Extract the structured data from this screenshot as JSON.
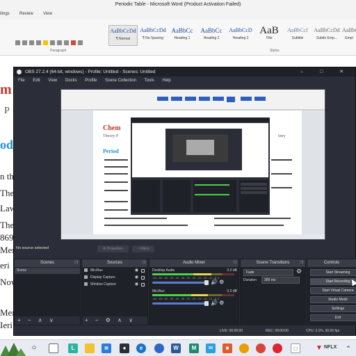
{
  "word": {
    "title": "Periodic Table  -  Microsoft Word (Product Activation Failed)",
    "tabs": [
      "ilings",
      "Review",
      "View"
    ],
    "styles": [
      {
        "preview": "AaBbCcDd",
        "name": "¶ Normal"
      },
      {
        "preview": "AaBbCcDd",
        "name": "¶ No Spacing"
      },
      {
        "preview": "AaBbCc",
        "name": "Heading 1"
      },
      {
        "preview": "AaBbCc",
        "name": "Heading 2"
      },
      {
        "preview": "AaBbCcD",
        "name": "Heading 3"
      },
      {
        "preview": "AaB",
        "name": "Title"
      },
      {
        "preview": "AaBbCcI",
        "name": "Subtitle"
      },
      {
        "preview": "AaBbCcDd",
        "name": "Subtle Emp..."
      },
      {
        "preview": "AaBbCcDd",
        "name": "Empl"
      }
    ],
    "group_paragraph": "Paragraph",
    "group_styles": "Styles",
    "doc_fragments": [
      "m",
      "P",
      "od",
      "n th",
      "The",
      "Law",
      "The",
      "869",
      "Men",
      "eri",
      "Now",
      "Mer",
      "Ieri"
    ]
  },
  "obs": {
    "title": "OBS 27.2.4 (64-bit, windows) - Profile: Untitled - Scenes: Untitled",
    "window_buttons": "– □ ✕",
    "menu": [
      "File",
      "Edit",
      "View",
      "Docks",
      "Profile",
      "Scene Collection",
      "Tools",
      "Help"
    ],
    "no_source": "No source selected",
    "properties_btn": "⚙ Properties",
    "filters_btn": "◔ Filters",
    "docks": {
      "scenes": {
        "title": "Scenes",
        "items": [
          "Scene"
        ]
      },
      "sources": {
        "title": "Sources",
        "items": [
          "Mic/Aux",
          "Display Capture",
          "Window Capture"
        ]
      },
      "mixer": {
        "title": "Audio Mixer",
        "channels": [
          {
            "name": "Desktop Audio",
            "db": "0.0 dB",
            "level": 0.72
          },
          {
            "name": "Mic/Aux",
            "db": "0.0 dB",
            "level": 0.68
          }
        ],
        "ticks": "-60 -55 -50 -45 -40 -35 -30 -25 -20 -15 -10 -5 0"
      },
      "transitions": {
        "title": "Scene Transitions",
        "fade": "Fade",
        "duration_label": "Duration",
        "duration_value": "300 ms"
      },
      "controls": {
        "title": "Controls",
        "buttons": [
          "Start Streaming",
          "Start Recording",
          "Start Virtual Camera",
          "Studio Mode",
          "Settings",
          "Exit"
        ]
      }
    },
    "status": {
      "live": "LIVE: 00:00:00",
      "rec": "REC: 00:00:00",
      "cpu": "CPU: 2.1%, 30.00 fps"
    },
    "preview": {
      "inner_doc_heading": "Chem",
      "inner_doc_sub": "Theory P",
      "inner_doc_right": "istry",
      "inner_doc_period": "Period"
    }
  },
  "taskbar": {
    "nflx": "NFLX"
  }
}
